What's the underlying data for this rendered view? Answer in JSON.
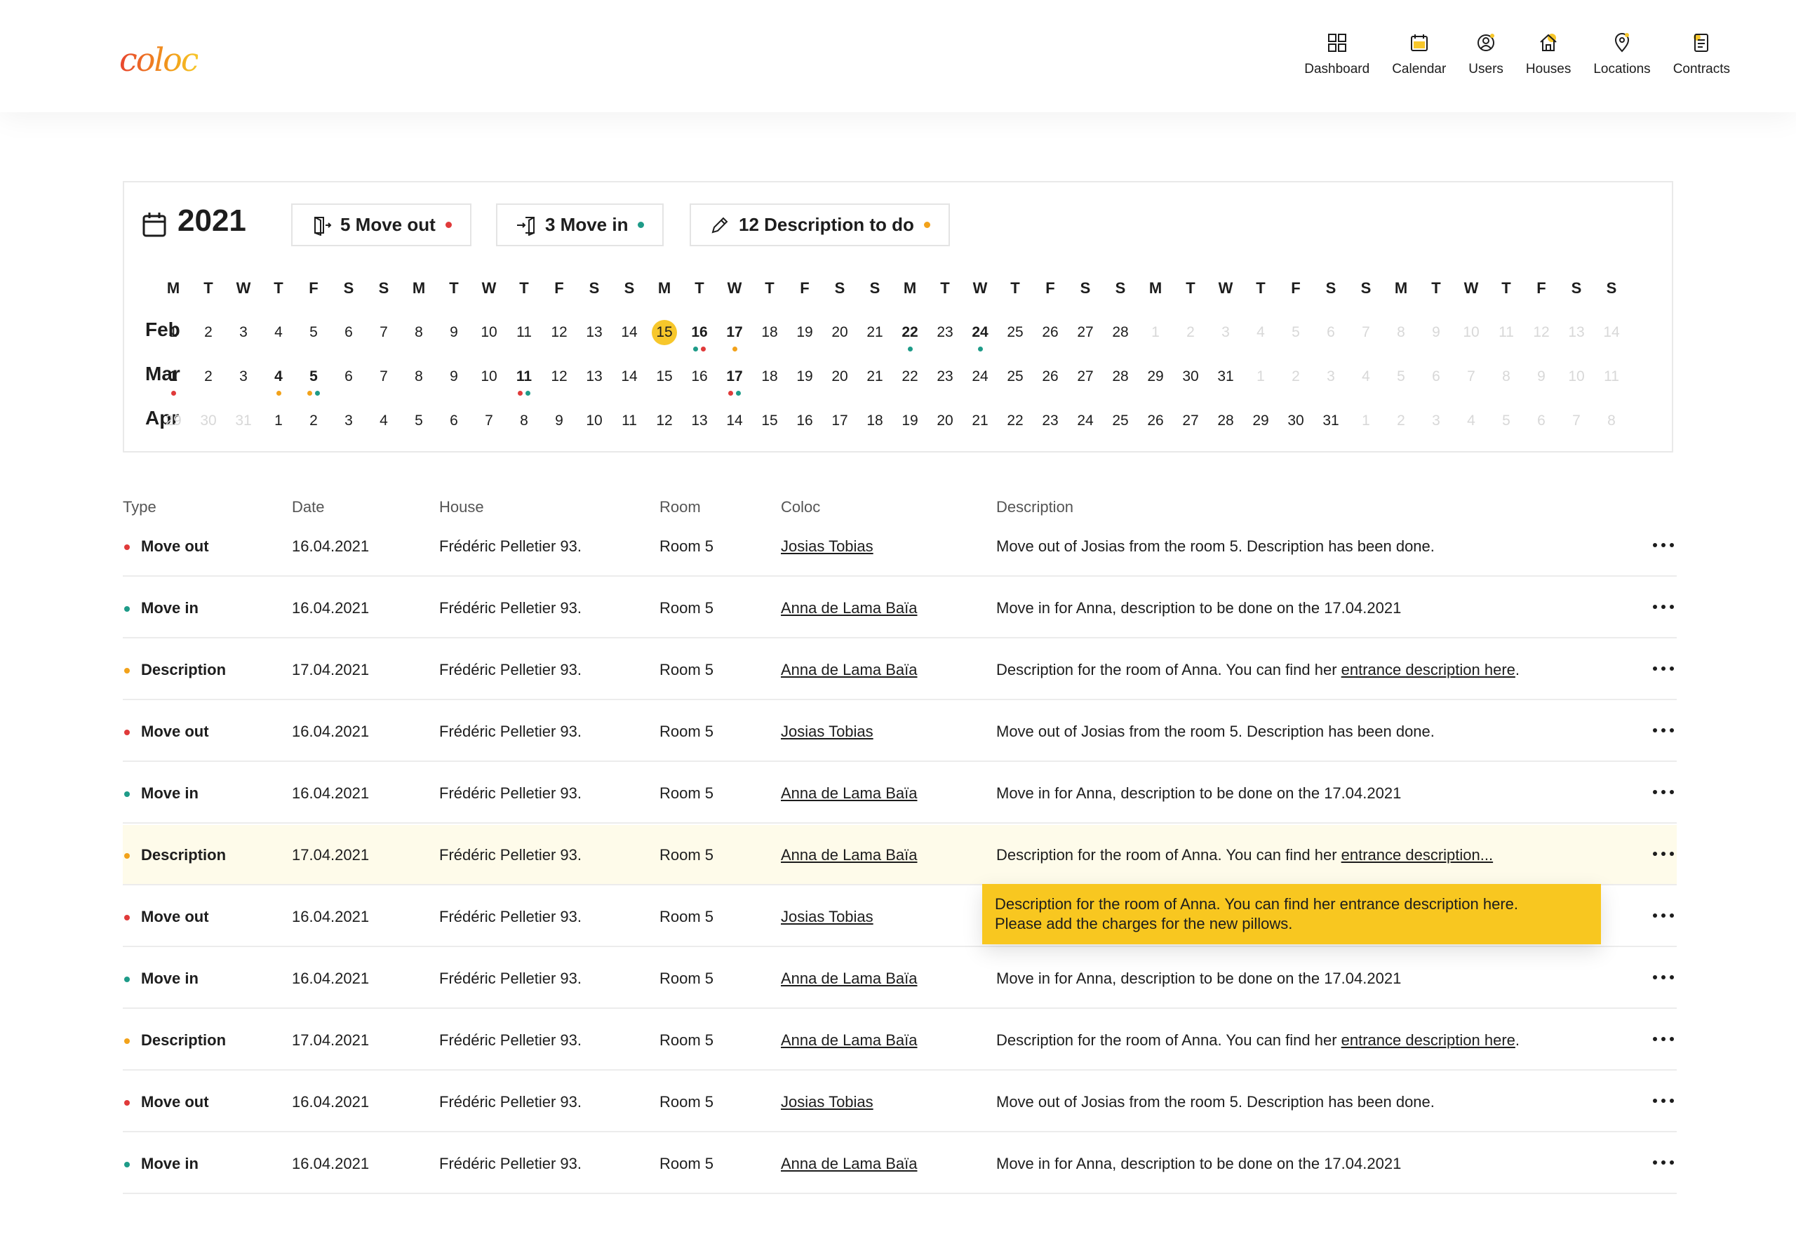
{
  "app": {
    "logo": "coloc"
  },
  "nav": [
    {
      "label": "Dashboard",
      "icon": "dashboard-icon"
    },
    {
      "label": "Calendar",
      "icon": "calendar-icon"
    },
    {
      "label": "Users",
      "icon": "users-icon"
    },
    {
      "label": "Houses",
      "icon": "houses-icon"
    },
    {
      "label": "Locations",
      "icon": "locations-icon"
    },
    {
      "label": "Contracts",
      "icon": "contracts-icon"
    }
  ],
  "colors": {
    "move_out": "#e03a3a",
    "move_in": "#1e9b88",
    "description": "#f2a21a",
    "accent": "#f7c72b"
  },
  "calendar": {
    "year": "2021",
    "chips": [
      {
        "label": "5 Move out",
        "icon": "door-out-icon",
        "color": "#e03a3a"
      },
      {
        "label": "3 Move in",
        "icon": "door-in-icon",
        "color": "#1e9b88"
      },
      {
        "label": "12 Description to do",
        "icon": "pencil-icon",
        "color": "#f2a21a"
      }
    ],
    "weekdays": [
      "M",
      "T",
      "W",
      "T",
      "F",
      "S",
      "S"
    ],
    "months": [
      {
        "label": "Feb",
        "lead": [],
        "days": 28,
        "trail": [
          1,
          2,
          3,
          4,
          5,
          6,
          7,
          8,
          9,
          10,
          11,
          12,
          13,
          14
        ],
        "today": 15,
        "bold": [
          16,
          17,
          22,
          24
        ],
        "dots": {
          "16": [
            "#1e9b88",
            "#e03a3a"
          ],
          "17": [
            "#f2a21a"
          ],
          "22": [
            "#1e9b88"
          ],
          "24": [
            "#1e9b88"
          ]
        }
      },
      {
        "label": "Mar",
        "lead": [],
        "days": 31,
        "trail": [
          1,
          2,
          3,
          4,
          5,
          6,
          7,
          8,
          9,
          10,
          11
        ],
        "today": null,
        "bold": [
          1,
          4,
          5,
          11,
          17
        ],
        "dots": {
          "1": [
            "#e03a3a"
          ],
          "4": [
            "#f2a21a"
          ],
          "5": [
            "#f2a21a",
            "#1e9b88"
          ],
          "11": [
            "#e03a3a",
            "#1e9b88"
          ],
          "17": [
            "#e03a3a",
            "#1e9b88"
          ]
        }
      },
      {
        "label": "Apr",
        "lead": [
          29,
          30,
          31
        ],
        "days": 31,
        "trail": [
          1,
          2,
          3,
          4,
          5,
          6,
          7,
          8
        ],
        "today": null,
        "bold": [],
        "dots": {}
      }
    ]
  },
  "table": {
    "headers": {
      "type": "Type",
      "date": "Date",
      "house": "House",
      "room": "Room",
      "coloc": "Coloc",
      "description": "Description"
    },
    "rows": [
      {
        "type": "Move out",
        "color": "#e03a3a",
        "date": "16.04.2021",
        "house": "Frédéric Pelletier 93.",
        "room": "Room 5",
        "coloc": "Josias Tobias",
        "desc": "Move out of Josias from the room 5. Description has been done.",
        "desc_link": ""
      },
      {
        "type": "Move in",
        "color": "#1e9b88",
        "date": "16.04.2021",
        "house": "Frédéric Pelletier 93.",
        "room": "Room 5",
        "coloc": "Anna de Lama Baïa",
        "desc": "Move in for Anna, description to be done on the 17.04.2021",
        "desc_link": ""
      },
      {
        "type": "Description",
        "color": "#f2a21a",
        "date": "17.04.2021",
        "house": "Frédéric Pelletier 93.",
        "room": "Room 5",
        "coloc": "Anna de Lama Baïa",
        "desc": "Description for the room of Anna. You can find her ",
        "desc_link": "entrance description here",
        "desc_after": "."
      },
      {
        "type": "Move out",
        "color": "#e03a3a",
        "date": "16.04.2021",
        "house": "Frédéric Pelletier 93.",
        "room": "Room 5",
        "coloc": "Josias Tobias",
        "desc": "Move out of Josias from the room 5. Description has been done.",
        "desc_link": ""
      },
      {
        "type": "Move in",
        "color": "#1e9b88",
        "date": "16.04.2021",
        "house": "Frédéric Pelletier 93.",
        "room": "Room 5",
        "coloc": "Anna de Lama Baïa",
        "desc": "Move in for Anna, description to be done on the 17.04.2021",
        "desc_link": ""
      },
      {
        "type": "Description",
        "color": "#f2a21a",
        "date": "17.04.2021",
        "house": "Frédéric Pelletier 93.",
        "room": "Room 5",
        "coloc": "Anna de Lama Baïa",
        "desc": "Description for the room of Anna. You can find her ",
        "desc_link": "entrance description...",
        "desc_after": "",
        "highlight": true
      },
      {
        "type": "Move out",
        "color": "#e03a3a",
        "date": "16.04.2021",
        "house": "Frédéric Pelletier 93.",
        "room": "Room 5",
        "coloc": "Josias Tobias",
        "desc": "",
        "desc_link": ""
      },
      {
        "type": "Move in",
        "color": "#1e9b88",
        "date": "16.04.2021",
        "house": "Frédéric Pelletier 93.",
        "room": "Room 5",
        "coloc": "Anna de Lama Baïa",
        "desc": "Move in for Anna, description to be done on the 17.04.2021",
        "desc_link": ""
      },
      {
        "type": "Description",
        "color": "#f2a21a",
        "date": "17.04.2021",
        "house": "Frédéric Pelletier 93.",
        "room": "Room 5",
        "coloc": "Anna de Lama Baïa",
        "desc": "Description for the room of Anna. You can find her ",
        "desc_link": "entrance description here",
        "desc_after": "."
      },
      {
        "type": "Move out",
        "color": "#e03a3a",
        "date": "16.04.2021",
        "house": "Frédéric Pelletier 93.",
        "room": "Room 5",
        "coloc": "Josias Tobias",
        "desc": "Move out of Josias from the room 5. Description has been done.",
        "desc_link": ""
      },
      {
        "type": "Move in",
        "color": "#1e9b88",
        "date": "16.04.2021",
        "house": "Frédéric Pelletier 93.",
        "room": "Room 5",
        "coloc": "Anna de Lama Baïa",
        "desc": "Move in for Anna, description to be done on the 17.04.2021",
        "desc_link": ""
      }
    ]
  },
  "tooltip": {
    "line1": "Description for the room of Anna. You can find her entrance description here.",
    "line2": "Please add the charges for the new pillows."
  }
}
